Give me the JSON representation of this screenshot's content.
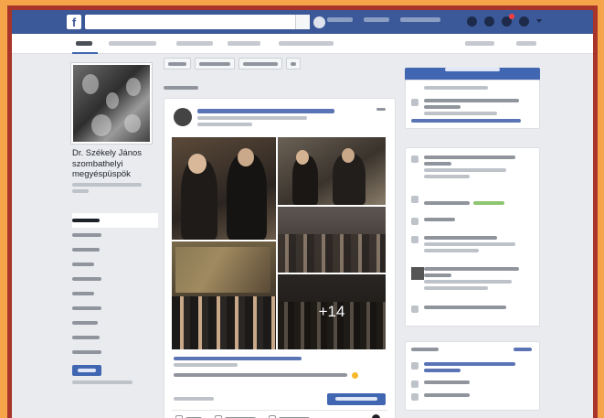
{
  "topbar": {
    "logo_icon": "facebook-logo-icon",
    "search_value": "",
    "search_icon": "search-icon",
    "nav_labels": [
      "",
      "",
      ""
    ],
    "icons": [
      "friend-requests-icon",
      "messages-icon",
      "notifications-icon",
      "help-icon",
      "chevron-down-icon"
    ]
  },
  "page": {
    "name": "Dr. Székely János szombathelyi megyéspüspök",
    "tabs": [
      "",
      "",
      "",
      "",
      "",
      "",
      ""
    ]
  },
  "left_nav": {
    "items": [
      "",
      "",
      "",
      "",
      "",
      "",
      "",
      "",
      "",
      ""
    ],
    "promote_label": "",
    "manage_label": ""
  },
  "center": {
    "composer_actions": [
      "",
      "",
      ""
    ],
    "section_label": "",
    "post": {
      "author": "",
      "photo_more_count": "+14",
      "link_label": "",
      "text": "",
      "reach_label": "",
      "boost_label": "",
      "actions": [
        "",
        "",
        ""
      ]
    }
  },
  "right": {
    "create_label": "",
    "cards": [
      "",
      "",
      "",
      "",
      "",
      "",
      "",
      "",
      ""
    ]
  },
  "colors": {
    "facebook_blue": "#3b5998",
    "button_blue": "#4267b2",
    "frame_red": "#a8342a",
    "outer_orange": "#f6a44a"
  }
}
